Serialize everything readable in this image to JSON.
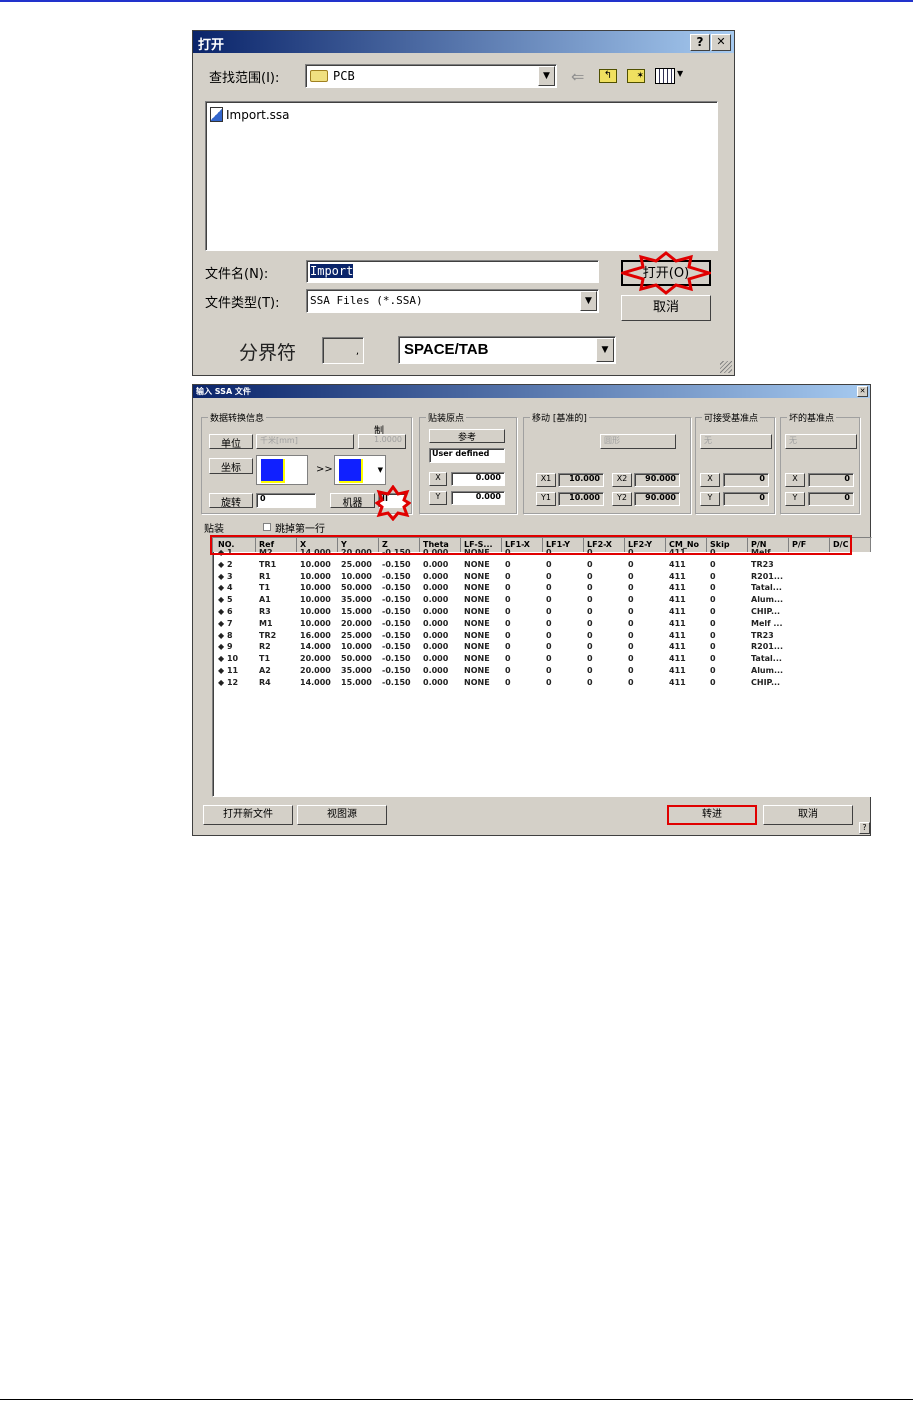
{
  "open_dialog": {
    "title": "打开",
    "help_label": "?",
    "close_label": "✕",
    "look_in_label": "查找范围(I):",
    "look_in_value": "PCB",
    "files": [
      {
        "name": "Import.ssa",
        "icon": "ssa-file-icon"
      }
    ],
    "filename_label": "文件名(N):",
    "filename_value": "Import",
    "filetype_label": "文件类型(T):",
    "filetype_value": "SSA Files (*.SSA)",
    "open_button": "打开(O)",
    "cancel_button": "取消",
    "delimiter_label": "分界符",
    "delimiter_char": ",",
    "delimiter_value": "SPACE/TAB",
    "toolbar_icons": [
      "back-arrow-icon",
      "up-folder-icon",
      "new-folder-icon",
      "view-menu-icon"
    ]
  },
  "import_dialog": {
    "title": "输入 SSA 文件",
    "close_label": "✕",
    "conversion": {
      "title": "数据转换信息",
      "unit_label": "单位",
      "unit_value": "千米[mm]",
      "scale_label": "制",
      "scale_value": "1.0000",
      "coord_label": "坐标",
      "arrow": ">>",
      "rotate_label": "旋转",
      "rotate_value": "0",
      "machine_label": "机器",
      "machine_value": "II"
    },
    "origin": {
      "title": "贴装原点",
      "ref_button": "参考",
      "mode_value": "User defined",
      "x_label": "X",
      "x_value": "0.000",
      "y_label": "Y",
      "y_value": "0.000"
    },
    "move": {
      "title": "移动 [基准的]",
      "shape_value": "圆形",
      "x1_label": "X1",
      "x1_value": "10.000",
      "x2_label": "X2",
      "x2_value": "90.000",
      "y1_label": "Y1",
      "y1_value": "10.000",
      "y2_label": "Y2",
      "y2_value": "90.000"
    },
    "accept_fid": {
      "title": "可接受基准点",
      "value": "无",
      "x_label": "X",
      "x_value": "0",
      "y_label": "Y",
      "y_value": "0"
    },
    "bad_fid": {
      "title": "坏的基准点",
      "value": "无",
      "x_label": "X",
      "x_value": "0",
      "y_label": "Y",
      "y_value": "0"
    },
    "placement_label": "贴装",
    "skip_first_label": "跳掉第一行",
    "skip_first_checked": false,
    "columns": [
      "NO.",
      "Ref",
      "X",
      "Y",
      "Z",
      "Theta",
      "LF-S...",
      "LF1-X",
      "LF1-Y",
      "LF2-X",
      "LF2-Y",
      "CM_No",
      "Skip",
      "P/N",
      "P/F",
      "D/C"
    ],
    "rows": [
      [
        "◆ 1",
        "M2",
        "14.000",
        "20.000",
        "-0.150",
        "0.000",
        "NONE",
        "0",
        "0",
        "0",
        "0",
        "411",
        "0",
        "Melf ...",
        "",
        ""
      ],
      [
        "◆ 2",
        "TR1",
        "10.000",
        "25.000",
        "-0.150",
        "0.000",
        "NONE",
        "0",
        "0",
        "0",
        "0",
        "411",
        "0",
        "TR23",
        "",
        ""
      ],
      [
        "◆ 3",
        "R1",
        "10.000",
        "10.000",
        "-0.150",
        "0.000",
        "NONE",
        "0",
        "0",
        "0",
        "0",
        "411",
        "0",
        "R201...",
        "",
        ""
      ],
      [
        "◆ 4",
        "T1",
        "10.000",
        "50.000",
        "-0.150",
        "0.000",
        "NONE",
        "0",
        "0",
        "0",
        "0",
        "411",
        "0",
        "Tatal...",
        "",
        ""
      ],
      [
        "◆ 5",
        "A1",
        "10.000",
        "35.000",
        "-0.150",
        "0.000",
        "NONE",
        "0",
        "0",
        "0",
        "0",
        "411",
        "0",
        "Alum...",
        "",
        ""
      ],
      [
        "◆ 6",
        "R3",
        "10.000",
        "15.000",
        "-0.150",
        "0.000",
        "NONE",
        "0",
        "0",
        "0",
        "0",
        "411",
        "0",
        "CHIP...",
        "",
        ""
      ],
      [
        "◆ 7",
        "M1",
        "10.000",
        "20.000",
        "-0.150",
        "0.000",
        "NONE",
        "0",
        "0",
        "0",
        "0",
        "411",
        "0",
        "Melf ...",
        "",
        ""
      ],
      [
        "◆ 8",
        "TR2",
        "16.000",
        "25.000",
        "-0.150",
        "0.000",
        "NONE",
        "0",
        "0",
        "0",
        "0",
        "411",
        "0",
        "TR23",
        "",
        ""
      ],
      [
        "◆ 9",
        "R2",
        "14.000",
        "10.000",
        "-0.150",
        "0.000",
        "NONE",
        "0",
        "0",
        "0",
        "0",
        "411",
        "0",
        "R201...",
        "",
        ""
      ],
      [
        "◆ 10",
        "T1",
        "20.000",
        "50.000",
        "-0.150",
        "0.000",
        "NONE",
        "0",
        "0",
        "0",
        "0",
        "411",
        "0",
        "Tatal...",
        "",
        ""
      ],
      [
        "◆ 11",
        "A2",
        "20.000",
        "35.000",
        "-0.150",
        "0.000",
        "NONE",
        "0",
        "0",
        "0",
        "0",
        "411",
        "0",
        "Alum...",
        "",
        ""
      ],
      [
        "◆ 12",
        "R4",
        "14.000",
        "15.000",
        "-0.150",
        "0.000",
        "NONE",
        "0",
        "0",
        "0",
        "0",
        "411",
        "0",
        "CHIP...",
        "",
        ""
      ]
    ],
    "open_new_button": "打开新文件",
    "view_source_button": "视图源",
    "import_button": "转进",
    "cancel_button": "取消",
    "help_label": "?"
  },
  "highlight_color": "#e00000"
}
